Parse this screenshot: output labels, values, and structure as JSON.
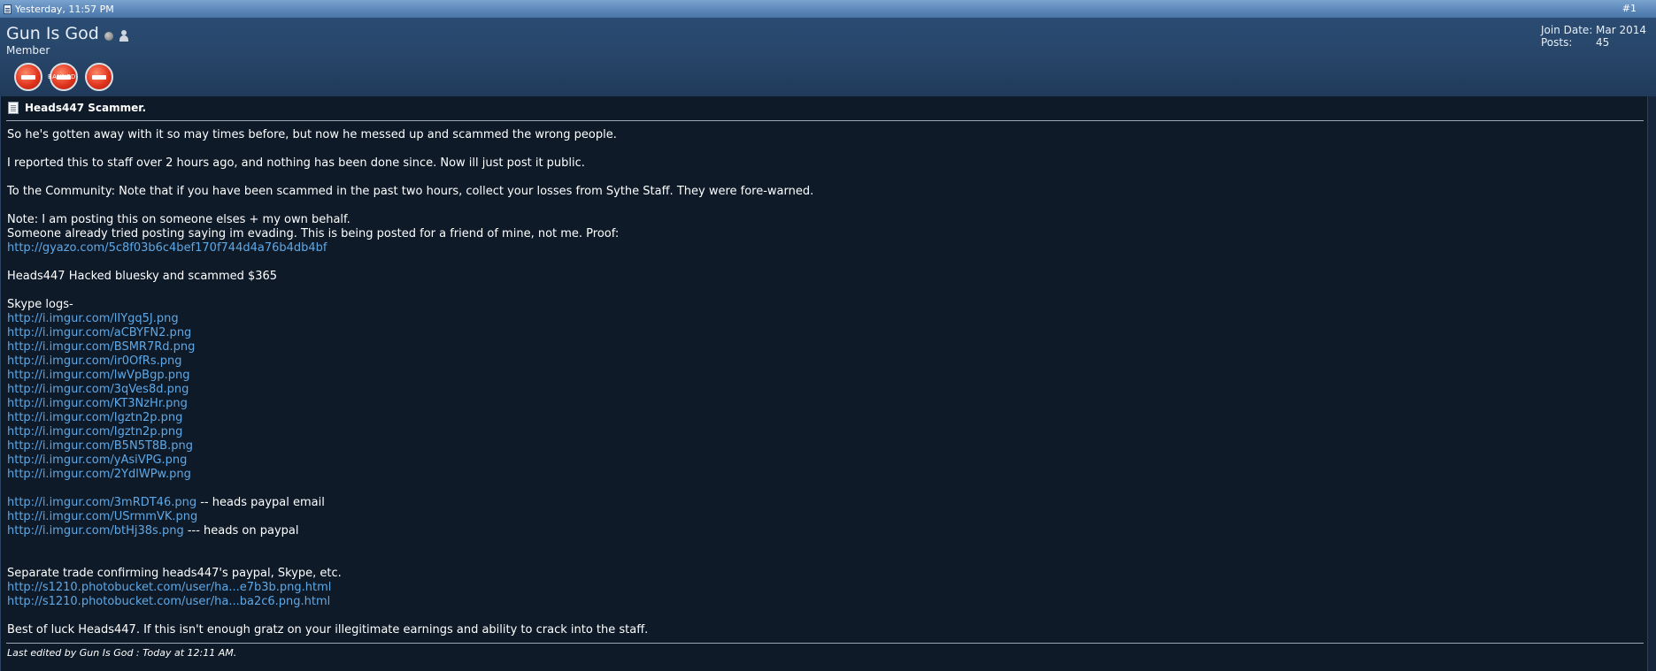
{
  "post_header": {
    "date": "Yesterday, 11:57 PM",
    "post_number": "#1"
  },
  "user": {
    "name": "Gun Is God",
    "title": "Member",
    "banned_label": "BANNED",
    "join_date_label": "Join Date:",
    "join_date": "Mar 2014",
    "posts_label": "Posts:",
    "posts": "45"
  },
  "post": {
    "title": "Heads447 Scammer.",
    "lines": [
      "So he's gotten away with it so may times before, but now he messed up and scammed the wrong people.",
      "I reported this to staff over 2 hours ago, and nothing has been done since. Now ill just post it public.",
      "To the Community: Note that if you have been scammed in the past two hours, collect your losses from Sythe Staff. They were fore-warned.",
      "Note: I am posting this on someone elses + my own behalf.",
      "Someone already tried posting saying im evading. This is being posted for a friend of mine, not me. Proof:",
      "Heads447 Hacked bluesky and scammed $365",
      "Skype logs-",
      "Separate trade confirming heads447's paypal, Skype, etc.",
      "Best of luck Heads447. If this isn't enough gratz on your illegitimate earnings and ability to crack into the staff."
    ],
    "proof_link": "http://gyazo.com/5c8f03b6c4bef170f744d4a76b4db4bf",
    "skype_links": [
      "http://i.imgur.com/lIYgq5J.png",
      "http://i.imgur.com/aCBYFN2.png",
      "http://i.imgur.com/BSMR7Rd.png",
      "http://i.imgur.com/ir0OfRs.png",
      "http://i.imgur.com/lwVpBgp.png",
      "http://i.imgur.com/3qVes8d.png",
      "http://i.imgur.com/KT3NzHr.png",
      "http://i.imgur.com/Igztn2p.png",
      "http://i.imgur.com/Igztn2p.png",
      "http://i.imgur.com/B5N5T8B.png",
      "http://i.imgur.com/yAsiVPG.png",
      "http://i.imgur.com/2YdlWPw.png"
    ],
    "paypal_links": [
      {
        "url": "http://i.imgur.com/3mRDT46.png",
        "note": " -- heads paypal email"
      },
      {
        "url": "http://i.imgur.com/USrmmVK.png",
        "note": ""
      },
      {
        "url": "http://i.imgur.com/btHj38s.png",
        "note": " --- heads on paypal"
      }
    ],
    "trade_links": [
      "http://s1210.photobucket.com/user/ha...e7b3b.png.html",
      "http://s1210.photobucket.com/user/ha...ba2c6.png.html"
    ],
    "last_edited": "Last edited by Gun Is God : Today at 12:11 AM."
  }
}
